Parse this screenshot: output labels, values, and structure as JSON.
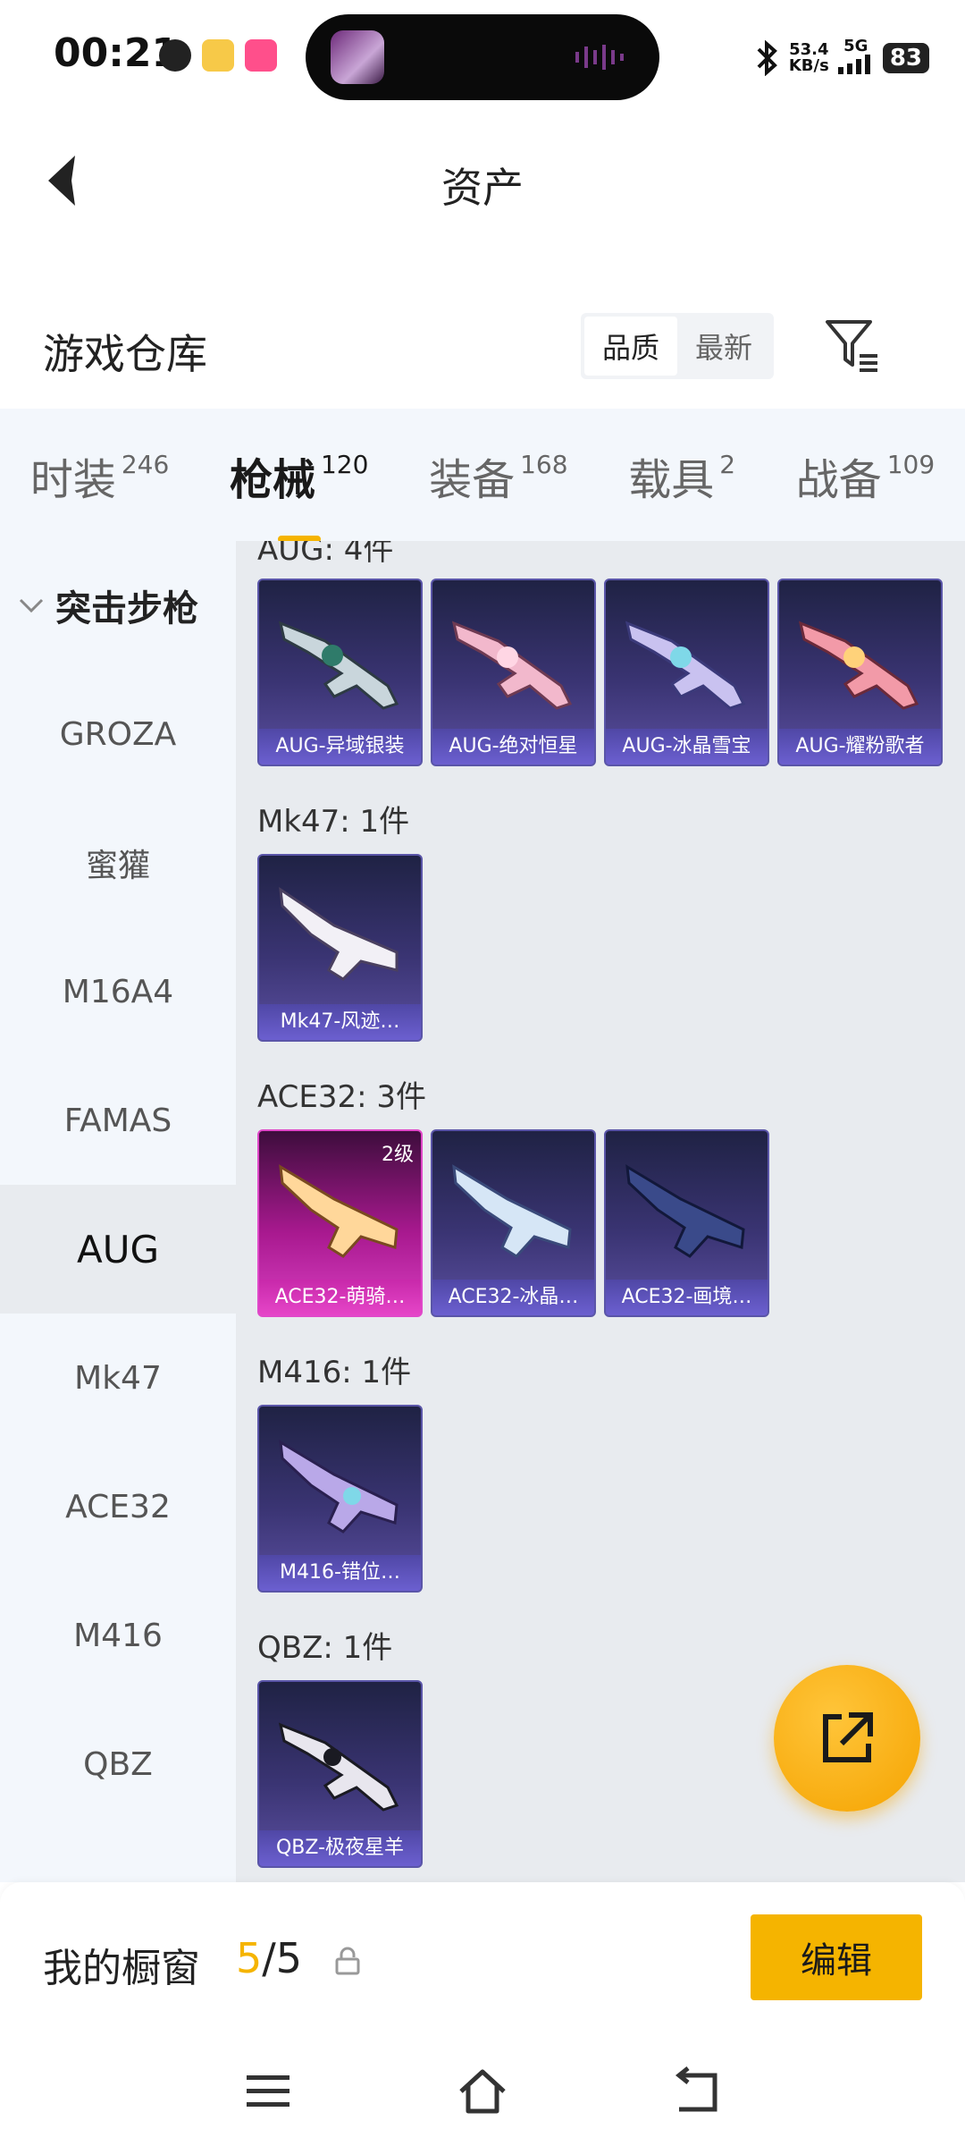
{
  "status_bar": {
    "time": "00:21",
    "net_speed": "53.4",
    "net_unit": "KB/s",
    "signal_type": "5G",
    "battery": "83"
  },
  "header": {
    "title": "资产"
  },
  "section": {
    "title": "游戏仓库",
    "sort_quality": "品质",
    "sort_newest": "最新"
  },
  "tabs": [
    {
      "label": "时装",
      "count": "246"
    },
    {
      "label": "枪械",
      "count": "120"
    },
    {
      "label": "装备",
      "count": "168"
    },
    {
      "label": "载具",
      "count": "2"
    },
    {
      "label": "战备",
      "count": "109"
    }
  ],
  "sidebar": {
    "group": "突击步枪",
    "items": [
      "GROZA",
      "蜜獾",
      "M16A4",
      "FAMAS",
      "AUG",
      "Mk47",
      "ACE32",
      "M416",
      "QBZ"
    ]
  },
  "groups": [
    {
      "label": "AUG: 4件",
      "cards": [
        "AUG-异域银装",
        "AUG-绝对恒星",
        "AUG-冰晶雪宝",
        "AUG-耀粉歌者"
      ]
    },
    {
      "label": "Mk47: 1件",
      "cards": [
        "Mk47-风迹…"
      ]
    },
    {
      "label": "ACE32: 3件",
      "cards": [
        "ACE32-萌骑…",
        "ACE32-冰晶…",
        "ACE32-画境…"
      ],
      "badge": "2级"
    },
    {
      "label": "M416: 1件",
      "cards": [
        "M416-错位…"
      ]
    },
    {
      "label": "QBZ: 1件",
      "cards": [
        "QBZ-极夜星羊"
      ]
    }
  ],
  "bottom": {
    "label": "我的橱窗",
    "count_used": "5",
    "count_sep": "/5",
    "edit": "编辑"
  }
}
